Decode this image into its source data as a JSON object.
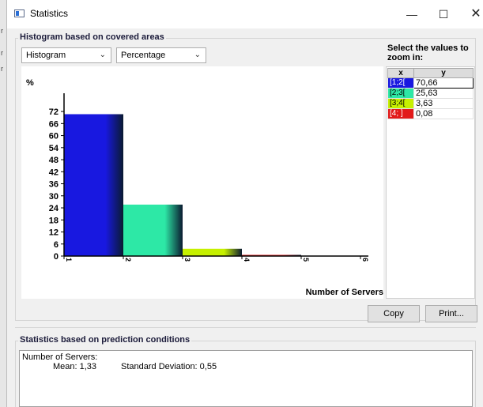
{
  "window": {
    "title": "Statistics",
    "controls": {
      "minimize": "—",
      "maximize": "☐",
      "close": "✕"
    }
  },
  "left_strip": [
    "r",
    "r",
    "r"
  ],
  "histogram_group": {
    "title": "Histogram based on covered areas",
    "chart_type_select": "Histogram",
    "scale_select": "Percentage"
  },
  "zoom": {
    "label": "Select the values to zoom in:",
    "columns": [
      "x",
      "y"
    ],
    "rows": [
      {
        "x": "[1;2[",
        "y": "70,66",
        "color": "#1818e0",
        "selected": true
      },
      {
        "x": "[2;3[",
        "y": "25,63",
        "color": "#2de8a6",
        "selected": false
      },
      {
        "x": "[3;4[",
        "y": "3,63",
        "color": "#c6f000",
        "selected": false
      },
      {
        "x": "[4; ]",
        "y": "0,08",
        "color": "#e21a1a",
        "selected": false
      }
    ]
  },
  "chart_data": {
    "type": "bar",
    "categories": [
      "[1;2[",
      "[2;3[",
      "[3;4[",
      "[4; ]"
    ],
    "values": [
      70.66,
      25.63,
      3.63,
      0.08
    ],
    "colors": [
      "#1818e0",
      "#2de8a6",
      "#c6f000",
      "#e21a1a"
    ],
    "x_ticks": [
      "1",
      "2",
      "3",
      "4",
      "5",
      "6"
    ],
    "y_ticks": [
      0,
      6,
      12,
      18,
      24,
      30,
      36,
      42,
      48,
      54,
      60,
      66,
      72
    ],
    "ylim": [
      0,
      74
    ],
    "ylabel": "%",
    "xlabel": "Number of Servers",
    "title": "",
    "grid": false
  },
  "buttons": {
    "copy": "Copy",
    "print": "Print..."
  },
  "prediction_group": {
    "title": "Statistics based on prediction conditions",
    "heading": "Number of Servers:",
    "mean": "Mean: 1,33",
    "std": "Standard Deviation: 0,55"
  }
}
